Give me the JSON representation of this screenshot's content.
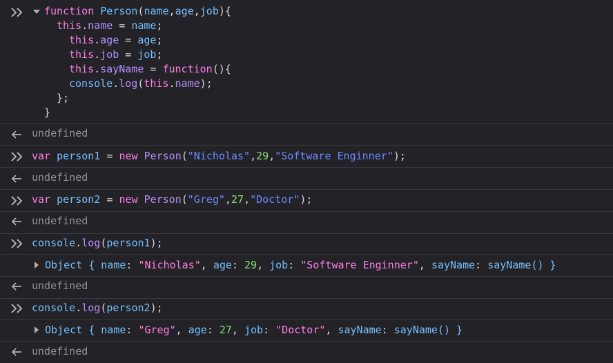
{
  "console": {
    "entries": [
      {
        "kind": "input",
        "lines": [
          [
            "function",
            " ",
            "Person",
            "(",
            "name",
            ",",
            "age",
            ",",
            "job",
            "){"
          ],
          [
            "this",
            ".",
            "name",
            " = ",
            "name",
            ";"
          ],
          [
            "this",
            ".",
            "age",
            " = ",
            "age",
            ";"
          ],
          [
            "this",
            ".",
            "job",
            " = ",
            "job",
            ";"
          ],
          [
            "this",
            ".",
            "sayName",
            " = ",
            "function",
            "(){"
          ],
          [
            "console",
            ".",
            "log",
            "(",
            "this",
            ".",
            "name",
            ");"
          ],
          [
            "};"
          ],
          [
            "}"
          ]
        ]
      },
      {
        "kind": "result",
        "text": "undefined"
      },
      {
        "kind": "input",
        "tokens": [
          "var",
          " ",
          "person1",
          " = ",
          "new",
          " ",
          "Person",
          "(",
          "\"Nicholas\"",
          ",",
          "29",
          ",",
          "\"Software Enginner\"",
          ");"
        ]
      },
      {
        "kind": "result",
        "text": "undefined"
      },
      {
        "kind": "input",
        "tokens": [
          "var",
          " ",
          "person2",
          " = ",
          "new",
          " ",
          "Person",
          "(",
          "\"Greg\"",
          ",",
          "27",
          ",",
          "\"Doctor\"",
          ");"
        ]
      },
      {
        "kind": "result",
        "text": "undefined"
      },
      {
        "kind": "input",
        "tokens": [
          "console",
          ".",
          "log",
          "(",
          "person1",
          ");"
        ]
      },
      {
        "kind": "output",
        "tokens": [
          "Object",
          " { ",
          "name",
          ": ",
          "\"Nicholas\"",
          ", ",
          "age",
          ": ",
          "29",
          ", ",
          "job",
          ": ",
          "\"Software Enginner\"",
          ", ",
          "sayName",
          ": ",
          "sayName()",
          " }"
        ]
      },
      {
        "kind": "result",
        "text": "undefined"
      },
      {
        "kind": "input",
        "tokens": [
          "console",
          ".",
          "log",
          "(",
          "person2",
          ");"
        ]
      },
      {
        "kind": "output",
        "tokens": [
          "Object",
          " { ",
          "name",
          ": ",
          "\"Greg\"",
          ", ",
          "age",
          ": ",
          "27",
          ", ",
          "job",
          ": ",
          "\"Doctor\"",
          ", ",
          "sayName",
          ": ",
          "sayName()",
          " }"
        ]
      },
      {
        "kind": "result",
        "text": "undefined"
      }
    ]
  },
  "colors": {
    "background": "#232327",
    "keyword": "#ff7de9",
    "function_name": "#75bfff",
    "property": "#b98eff",
    "string": "#6b89ff",
    "number": "#86de74",
    "muted": "#939395",
    "separator": "#38383d"
  },
  "icons": {
    "input_prompt": "double-chevron-right-icon",
    "result_arrow": "arrow-left-icon",
    "expand": "triangle-right-icon",
    "collapse": "triangle-down-icon"
  }
}
